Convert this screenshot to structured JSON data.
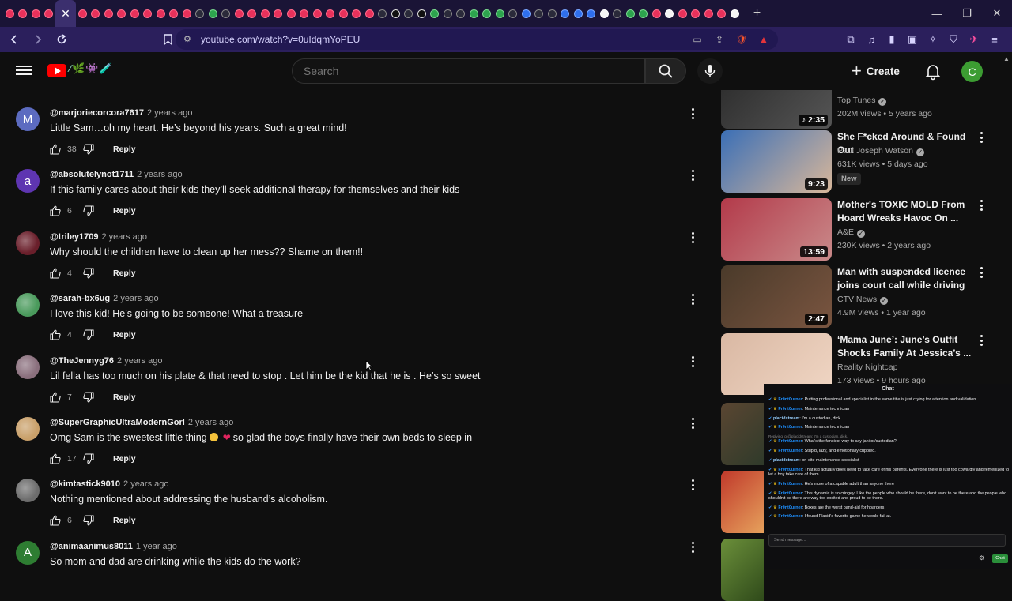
{
  "browser": {
    "url": "youtube.com/watch?v=0uIdqmYoPEU",
    "new_tab": "+",
    "minimize": "—",
    "maximize": "❐",
    "close": "✕",
    "tab_close": "✕"
  },
  "header": {
    "search_placeholder": "Search",
    "create_label": "Create",
    "avatar_letter": "C",
    "logo_doodle": "⁄🌿👾🧪"
  },
  "comments": [
    {
      "avatar": "M",
      "avatar_color": "#5c6bc0",
      "handle": "@marjoriecorcora7617",
      "time": "2 years ago",
      "text": "Little Sam…oh my heart. He’s beyond his years. Such a great mind!",
      "likes": "38",
      "reply": "Reply"
    },
    {
      "avatar": "a",
      "avatar_color": "#5e35b1",
      "handle": "@absolutelynot1711",
      "time": "2 years ago",
      "text": "If this family cares about their kids they’ll seek additional therapy for themselves and their kids",
      "likes": "6",
      "reply": "Reply"
    },
    {
      "avatar": "",
      "avatar_color": "#6a1f2b",
      "handle": "@triley1709",
      "time": "2 years ago",
      "text": "Why should the children have to clean up her mess?? Shame on them!!",
      "likes": "4",
      "reply": "Reply"
    },
    {
      "avatar": "",
      "avatar_color": "#4a9a5c",
      "handle": "@sarah-bx6ug",
      "time": "2 years ago",
      "text": "I love this kid! He’s going to be someone! What a treasure",
      "likes": "4",
      "reply": "Reply"
    },
    {
      "avatar": "",
      "avatar_color": "#8a6f7d",
      "handle": "@TheJennyg76",
      "time": "2 years ago",
      "text": "Lil fella has too much on his plate & that need to stop . Let him be the kid that he is . He’s so sweet",
      "likes": "7",
      "reply": "Reply"
    },
    {
      "avatar": "",
      "avatar_color": "#c9a06a",
      "handle": "@SuperGraphicUltraModernGorl",
      "time": "2 years ago",
      "text_before": "Omg Sam is the sweetest little thing",
      "text_after": "so glad the boys finally have their own beds to sleep in",
      "likes": "17",
      "reply": "Reply"
    },
    {
      "avatar": "",
      "avatar_color": "#6d6d6d",
      "handle": "@kimtastick9010",
      "time": "2 years ago",
      "text": "Nothing mentioned about addressing the husband’s alcoholism.",
      "likes": "6",
      "reply": "Reply"
    },
    {
      "avatar": "A",
      "avatar_color": "#2e7d32",
      "handle": "@animaanimus8011",
      "time": "1 year ago",
      "text": "So mom and dad are drinking while the kids do the work?",
      "likes": "",
      "reply": "Reply"
    }
  ],
  "sidebar": [
    {
      "title": "",
      "channel": "Top Tunes",
      "meta": "202M views • 5 years ago",
      "duration": "♪ 2:35",
      "thumb_colors": [
        "#2a2a2a",
        "#555"
      ]
    },
    {
      "title": "She F*cked Around & Found Out",
      "channel": "Paul Joseph Watson",
      "meta": "631K views • 5 days ago",
      "duration": "9:23",
      "badge": "New",
      "thumb_colors": [
        "#3b6fb6",
        "#d8b79a"
      ]
    },
    {
      "title": "Mother's TOXIC MOLD From Hoard Wreaks Havoc On ...",
      "channel": "A&E",
      "meta": "230K views • 2 years ago",
      "duration": "13:59",
      "thumb_colors": [
        "#b33a4a",
        "#c98a8a"
      ]
    },
    {
      "title": "Man with suspended licence joins court call while driving",
      "channel": "CTV News",
      "meta": "4.9M views • 1 year ago",
      "duration": "2:47",
      "thumb_colors": [
        "#4a3a2a",
        "#7a5540"
      ]
    },
    {
      "title": "‘Mama June’: June’s Outfit Shocks Family At Jessica’s ...",
      "channel": "Reality Nightcap",
      "meta": "173 views • 9 hours ago",
      "duration": "",
      "thumb_colors": [
        "#d9b8a3",
        "#f0d6c4"
      ]
    }
  ],
  "chat": {
    "title": "Chat",
    "input_placeholder": "Send message...",
    "send_label": "Chat",
    "lines": [
      {
        "user": "Fr0nt0urner",
        "text": "Putting professional and specialist in the same title is just crying for attention and validation",
        "placid": false
      },
      {
        "user": "Fr0nt0urner",
        "text": "Maintenance technician",
        "placid": false
      },
      {
        "user": "placidstream",
        "text": "I'm a custodian, dick.",
        "placid": true
      },
      {
        "user": "Fr0nt0urner",
        "text": "Maintenance technician",
        "placid": false
      },
      {
        "user": "Fr0nt0urner",
        "text": "What's the fanciest way to say janitor/custodian?",
        "placid": false,
        "sub": "Replying to @placidstream: I'm a custodian, dick."
      },
      {
        "user": "Fr0nt0urner",
        "text": "Stupid, lazy, and emotionally crippled.",
        "placid": false
      },
      {
        "user": "placidstream",
        "text": "on-site maintenance specialist",
        "placid": true
      },
      {
        "user": "Fr0nt0urner",
        "text": "That kid actually does need to take care of his parents. Everyone there is just too cowardly and femenized to let a boy take care of them.",
        "placid": false
      },
      {
        "user": "Fr0nt0urner",
        "text": "He's more of a capable adult than anyone there",
        "placid": false
      },
      {
        "user": "Fr0nt0urner",
        "text": "This dynamic is so cringey. Like the people who should be there, don't want to be there and the people who shouldn't be there are way too excited and proud to be there.",
        "placid": false
      },
      {
        "user": "Fr0nt0urner",
        "text": "Boxes are the worst band-aid for hoarders",
        "placid": false
      },
      {
        "user": "Fr0nt0urner",
        "text": "I found Placid's favorite game he would fail at.",
        "placid": false
      }
    ]
  }
}
